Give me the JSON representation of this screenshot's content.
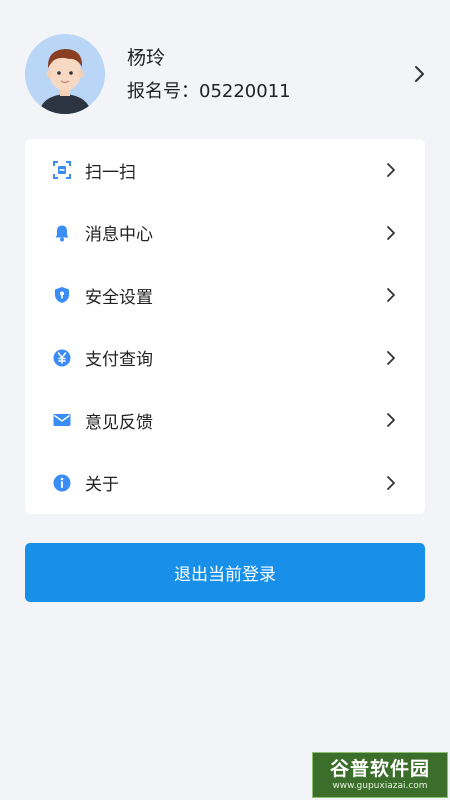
{
  "profile": {
    "name": "杨玲",
    "id_label": "报名号：",
    "id_value": "05220011"
  },
  "menu": [
    {
      "label": "扫一扫",
      "icon": "scan-icon"
    },
    {
      "label": "消息中心",
      "icon": "bell-icon"
    },
    {
      "label": "安全设置",
      "icon": "shield-icon"
    },
    {
      "label": "支付查询",
      "icon": "yen-icon"
    },
    {
      "label": "意见反馈",
      "icon": "mail-icon"
    },
    {
      "label": "关于",
      "icon": "info-icon"
    }
  ],
  "logout_label": "退出当前登录",
  "watermark": {
    "main": "谷普软件园",
    "sub": "www.gupuxiazai.com"
  },
  "colors": {
    "accent": "#1890ea",
    "icon": "#3a8df5",
    "background": "#f3f4f8",
    "card": "#ffffff"
  }
}
